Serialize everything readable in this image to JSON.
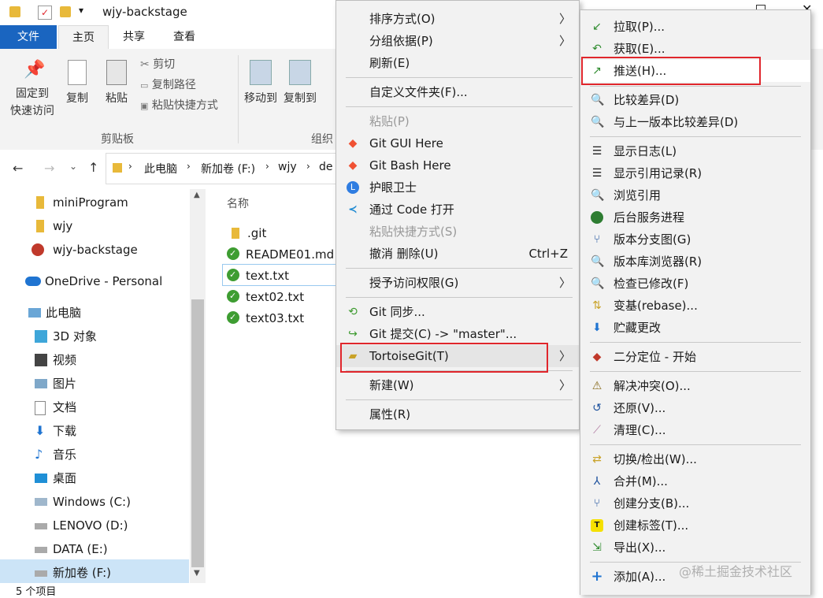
{
  "window": {
    "title": "wjy-backstage"
  },
  "ribbon_tabs": [
    "文件",
    "主页",
    "共享",
    "查看"
  ],
  "ribbon": {
    "pin_label_1": "固定到",
    "pin_label_2": "快速访问",
    "copy": "复制",
    "paste": "粘贴",
    "cut": "剪切",
    "copy_path": "复制路径",
    "paste_shortcut": "粘贴快捷方式",
    "clipboard_group": "剪贴板",
    "move_to": "移动到",
    "copy_to": "复制到",
    "organize_group": "组织"
  },
  "address": {
    "crumbs": [
      "此电脑",
      "新加卷 (F:)",
      "wjy",
      "de"
    ]
  },
  "nav": [
    "miniProgram",
    "wjy",
    "wjy-backstage",
    "OneDrive - Personal",
    "此电脑",
    "3D 对象",
    "视频",
    "图片",
    "文档",
    "下载",
    "音乐",
    "桌面",
    "Windows (C:)",
    "LENOVO (D:)",
    "DATA (E:)",
    "新加卷 (F:)"
  ],
  "files": {
    "column_name": "名称",
    "items": [
      ".git",
      "README01.md",
      "text.txt",
      "text02.txt",
      "text03.txt"
    ]
  },
  "status": {
    "count": "5 个项目"
  },
  "context_menu": {
    "items": {
      "sort": "排序方式(O)",
      "group": "分组依据(P)",
      "refresh": "刷新(E)",
      "customize": "自定义文件夹(F)...",
      "paste": "粘贴(P)",
      "git_gui": "Git GUI Here",
      "git_bash": "Git Bash Here",
      "eye_guard": "护眼卫士",
      "vscode": "通过 Code 打开",
      "paste_shortcut": "粘贴快捷方式(S)",
      "undo_delete": "撤消 删除(U)",
      "undo_shortcut": "Ctrl+Z",
      "grant_access": "授予访问权限(G)",
      "git_sync": "Git 同步...",
      "git_commit": "Git 提交(C) -> \"master\"...",
      "tortoise": "TortoiseGit(T)",
      "new": "新建(W)",
      "properties": "属性(R)"
    }
  },
  "submenu": {
    "items": {
      "pull": "拉取(P)...",
      "fetch": "获取(E)...",
      "push": "推送(H)...",
      "diff": "比较差异(D)",
      "diff_prev": "与上一版本比较差异(D)",
      "log": "显示日志(L)",
      "reflog": "显示引用记录(R)",
      "browse_ref": "浏览引用",
      "daemon": "后台服务进程",
      "rev_graph": "版本分支图(G)",
      "repo_browser": "版本库浏览器(R)",
      "check_mod": "检查已修改(F)",
      "rebase": "变基(rebase)...",
      "stash": "贮藏更改",
      "bisect": "二分定位 - 开始",
      "resolve": "解决冲突(O)...",
      "revert": "还原(V)...",
      "cleanup": "清理(C)...",
      "switch": "切换/检出(W)...",
      "merge": "合并(M)...",
      "branch": "创建分支(B)...",
      "tag": "创建标签(T)...",
      "export": "导出(X)...",
      "add": "添加(A)..."
    }
  },
  "watermark": "@稀土掘金技术社区",
  "colors": {
    "accent": "#1a65c0",
    "highlight": "#e0262c",
    "menu_bg": "#f2f2f2"
  }
}
